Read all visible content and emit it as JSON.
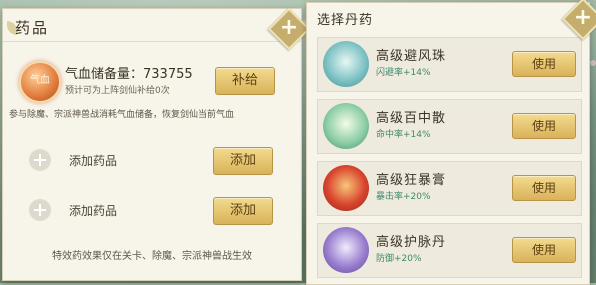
{
  "left_panel": {
    "title": "药品",
    "storage": {
      "label": "气血储备量：733755",
      "sub": "预计可为上阵剑仙补给0次",
      "orb_text": "气血",
      "supply_button": "补给"
    },
    "description": "参与除魔、宗派神兽战消耗气血储备，恢复剑仙当前气血",
    "slots": [
      {
        "label": "添加药品",
        "button": "添加"
      },
      {
        "label": "添加药品",
        "button": "添加"
      }
    ],
    "footer": "特效药效果仅在关卡、除魔、宗派神兽战生效"
  },
  "right_panel": {
    "title": "选择丹药",
    "items": [
      {
        "name": "高级避风珠",
        "effect": "闪避率+14%",
        "button": "使用",
        "color": "#7fc3c6"
      },
      {
        "name": "高级百中散",
        "effect": "命中率+14%",
        "button": "使用",
        "color": "#8fcfa8"
      },
      {
        "name": "高级狂暴膏",
        "effect": "暴击率+20%",
        "button": "使用",
        "color": "#d9452f"
      },
      {
        "name": "高级护脉丹",
        "effect": "防御+20%",
        "button": "使用",
        "color": "#9a7fd0"
      }
    ]
  },
  "icons": {
    "close": "close-plus-icon",
    "add": "add-plus-icon"
  }
}
